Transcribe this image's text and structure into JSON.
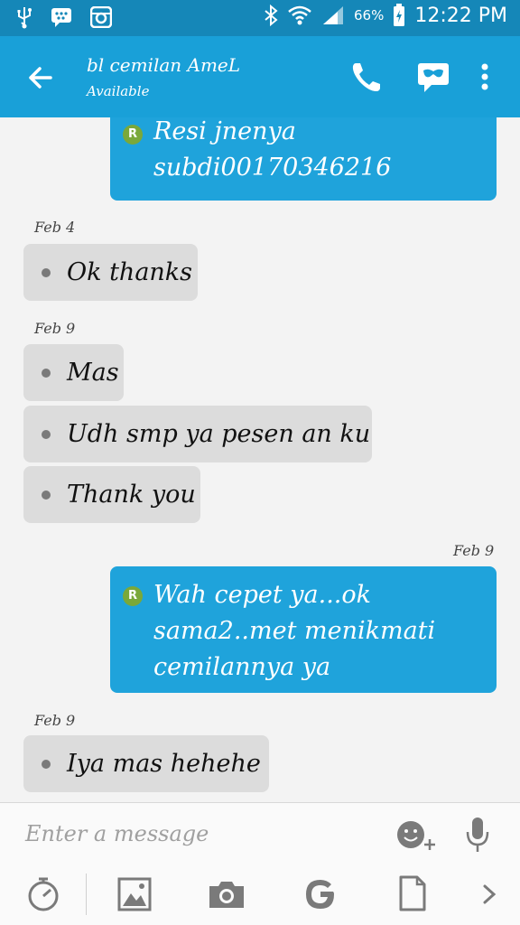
{
  "status_bar": {
    "battery": "66%",
    "time": "12:22 PM"
  },
  "header": {
    "title": "bl cemilan AmeL",
    "subtitle": "Available"
  },
  "messages": [
    {
      "dir": "out",
      "badge": "R",
      "lines": [
        "Resi jnenya",
        "subdi00170346216"
      ]
    },
    {
      "dir": "date",
      "text": "Feb 4"
    },
    {
      "dir": "in",
      "text": "Ok thanks"
    },
    {
      "dir": "date",
      "text": "Feb 9"
    },
    {
      "dir": "in",
      "text": "Mas"
    },
    {
      "dir": "in",
      "text": "Udh smp ya pesen an ku"
    },
    {
      "dir": "in",
      "text": "Thank you"
    },
    {
      "dir": "date",
      "text": "Feb 9"
    },
    {
      "dir": "out",
      "badge": "R",
      "lines": [
        "Wah cepet ya...ok",
        "sama2..met menikmati",
        "cemilannya ya"
      ]
    },
    {
      "dir": "date",
      "text": "Feb 9"
    },
    {
      "dir": "in",
      "text": "Iya mas hehehe"
    }
  ],
  "composer": {
    "placeholder": "Enter a message"
  },
  "colors": {
    "status_bar": "#1587b8",
    "app_bar": "#19a0d8",
    "outgoing_bubble": "#1fa3db",
    "incoming_bubble": "#dcdcdc",
    "read_badge": "#7aa83a"
  }
}
